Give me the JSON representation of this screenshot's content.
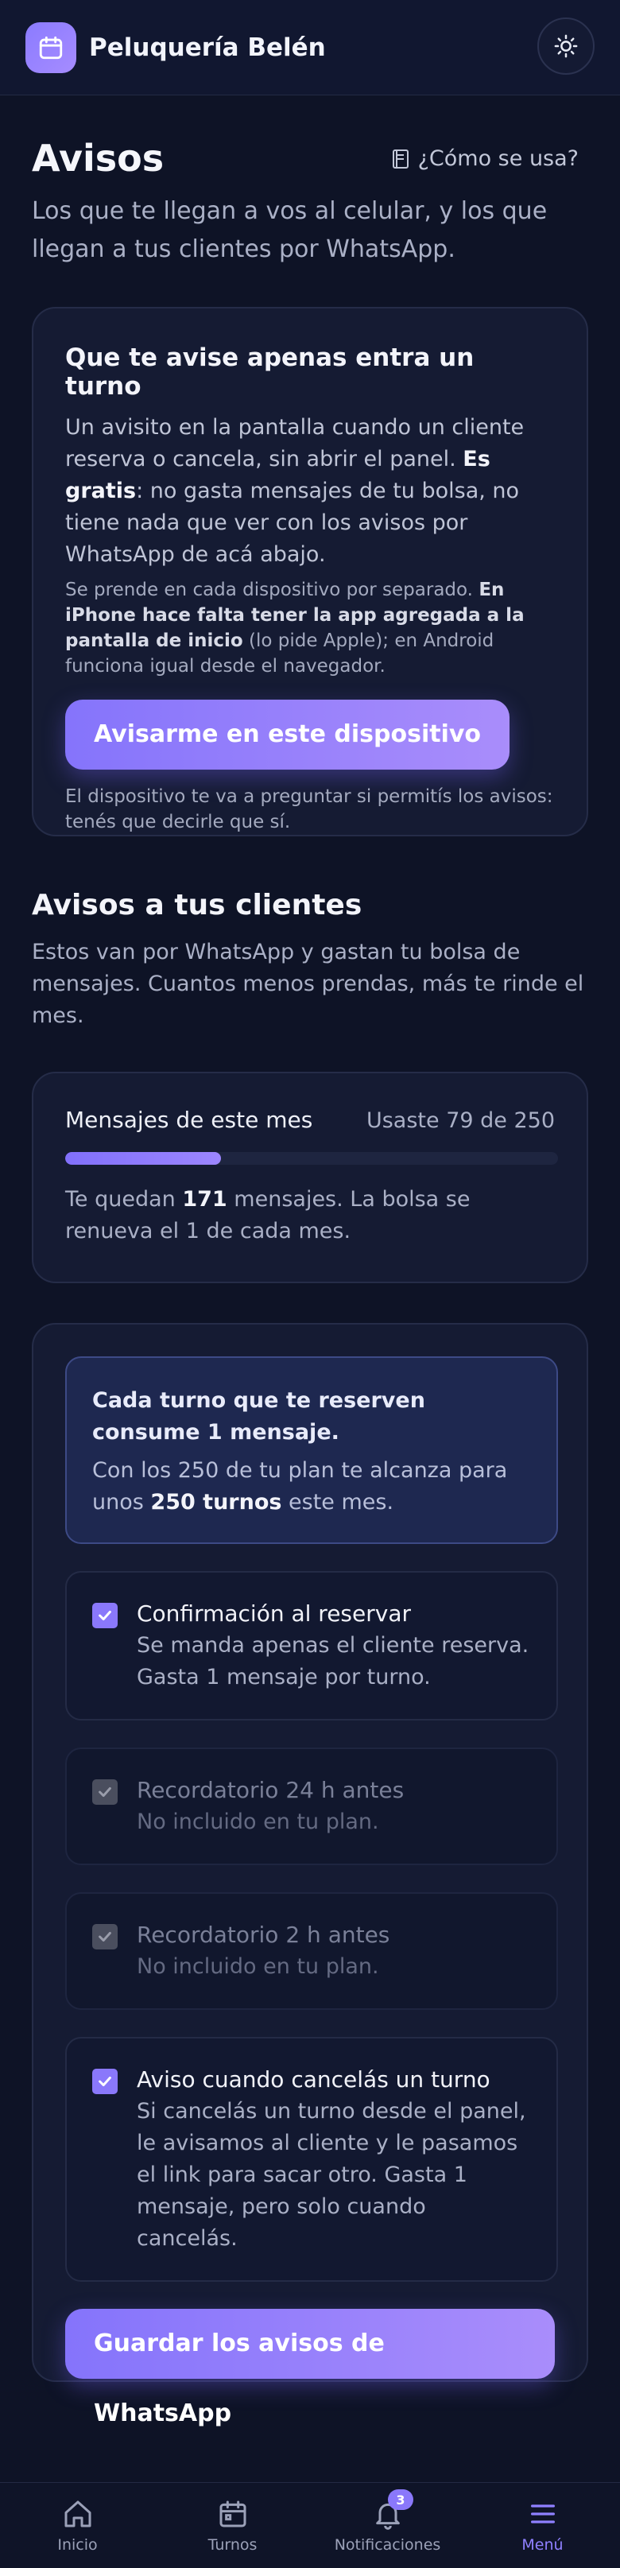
{
  "header": {
    "app_name": "Peluquería Belén",
    "logo_icon": "calendar-icon",
    "theme_icon": "sun-icon"
  },
  "page": {
    "title": "Avisos",
    "howto_label": "¿Cómo se usa?",
    "subtitle": "Los que te llegan a vos al celular, y los que llegan a tus clientes por WhatsApp."
  },
  "device_card": {
    "title": "Que te avise apenas entra un turno",
    "body_before": "Un avisito en la pantalla cuando un cliente reserva o cancela, sin abrir el panel. ",
    "body_bold": "Es gratis",
    "body_after": ": no gasta mensajes de tu bolsa, no tiene nada que ver con los avisos por WhatsApp de acá abajo.",
    "small_before": "Se prende en cada dispositivo por separado. ",
    "small_bold": "En iPhone hace falta tener la app agregada a la pantalla de inicio",
    "small_after": " (lo pide Apple); en Android funciona igual desde el navegador.",
    "button_label": "Avisarme en este dispositivo",
    "hint": "El dispositivo te va a preguntar si permitís los avisos: tenés que decirle que sí."
  },
  "clients_section": {
    "title": "Avisos a tus clientes",
    "subtitle": "Estos van por WhatsApp y gastan tu bolsa de mensajes. Cuantos menos prendas, más te rinde el mes."
  },
  "usage": {
    "label": "Mensajes de este mes",
    "used_text": "Usaste 79 de 250",
    "used": 79,
    "total": 250,
    "remaining_before": "Te quedan ",
    "remaining": "171",
    "remaining_after": " mensajes. La bolsa se renueva el 1 de cada mes."
  },
  "info": {
    "title": "Cada turno que te reserven consume 1 mensaje.",
    "body_before": "Con los 250 de tu plan te alcanza para unos ",
    "body_bold": "250 turnos",
    "body_after": " este mes."
  },
  "options": [
    {
      "title": "Confirmación al reservar",
      "desc": "Se manda apenas el cliente reserva. Gasta 1 mensaje por turno.",
      "checked": true,
      "disabled": false
    },
    {
      "title": "Recordatorio 24 h antes",
      "desc": "No incluido en tu plan.",
      "checked": true,
      "disabled": true
    },
    {
      "title": "Recordatorio 2 h antes",
      "desc": "No incluido en tu plan.",
      "checked": true,
      "disabled": true
    },
    {
      "title": "Aviso cuando cancelás un turno",
      "desc": "Si cancelás un turno desde el panel, le avisamos al cliente y le pasamos el link para sacar otro. Gasta 1 mensaje, pero solo cuando cancelás.",
      "checked": true,
      "disabled": false
    }
  ],
  "save_button": "Guardar los avisos de WhatsApp",
  "nav": {
    "items": [
      {
        "label": "Inicio",
        "icon": "home-icon"
      },
      {
        "label": "Turnos",
        "icon": "calendar-icon"
      },
      {
        "label": "Notificaciones",
        "icon": "bell-icon",
        "badge": "3"
      },
      {
        "label": "Menú",
        "icon": "menu-icon",
        "active": true
      }
    ]
  },
  "colors": {
    "accent": "#8a78fb",
    "background": "#0e1326",
    "card": "#151b33"
  }
}
